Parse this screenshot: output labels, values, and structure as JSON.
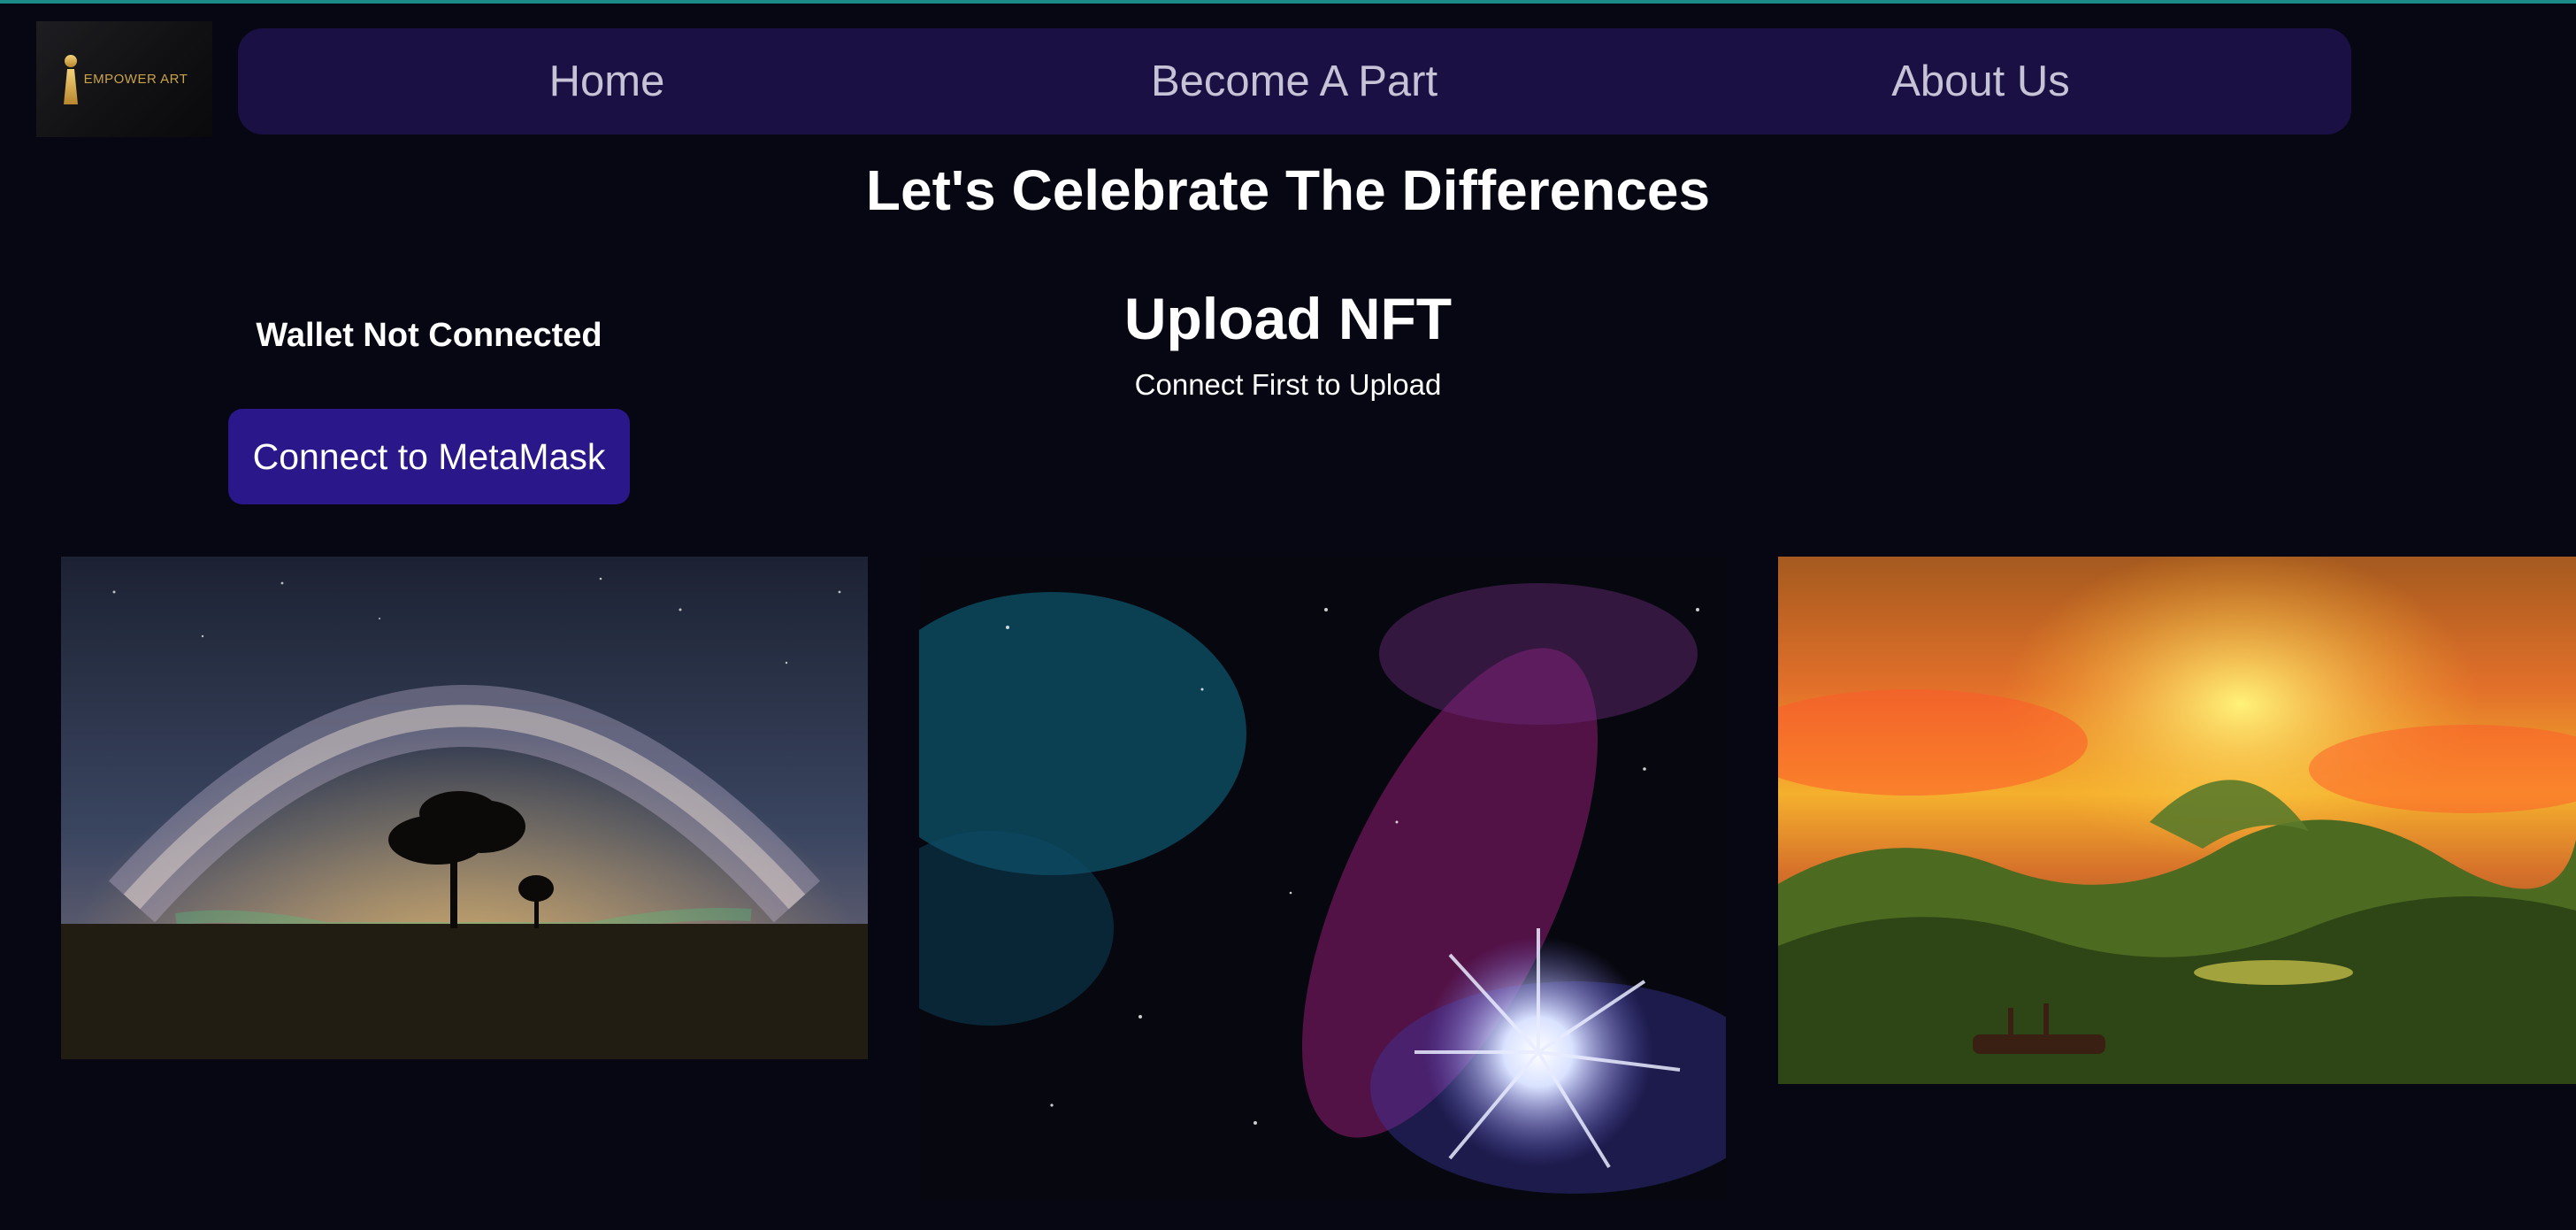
{
  "brand": {
    "logo_text": "EMPOWER ART",
    "accent_color": "#2a178a",
    "nav_bg_color": "#1b1044",
    "page_bg_color": "#070713"
  },
  "nav": {
    "items": [
      {
        "label": "Home"
      },
      {
        "label": "Become A Part"
      },
      {
        "label": "About Us"
      }
    ]
  },
  "hero": {
    "headline": "Let's Celebrate The Differences"
  },
  "wallet": {
    "status": "Wallet Not Connected",
    "connect_label": "Connect to MetaMask"
  },
  "upload": {
    "title": "Upload NFT",
    "subtitle": "Connect First to Upload"
  },
  "gallery": {
    "items": [
      {
        "subject": "milky-way-tree-night-sky"
      },
      {
        "subject": "galaxy-nebula-painting"
      },
      {
        "subject": "stormy-sea-sunset-painting"
      }
    ]
  }
}
